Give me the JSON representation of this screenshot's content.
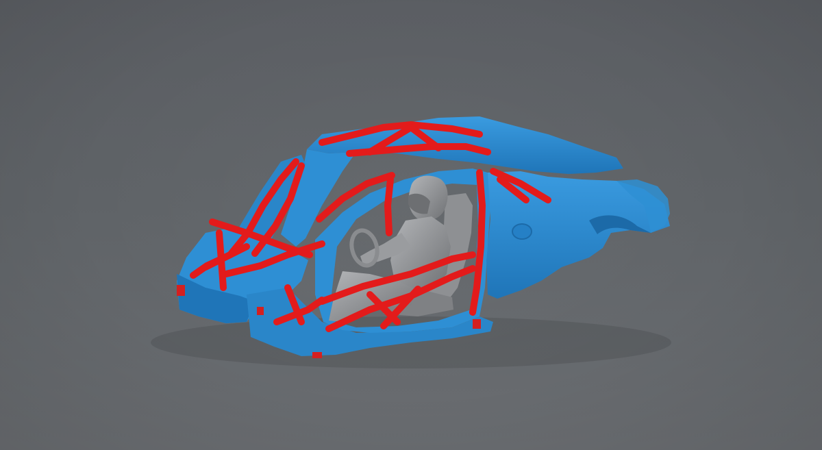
{
  "scene": {
    "colors": {
      "background_top": "#5b5e63",
      "background_bottom": "#6a6d71",
      "body_shell": "#2e8fd4",
      "body_shell_dark": "#1f6fb0",
      "roll_cage": "#e31b1b",
      "roll_cage_dark": "#a80f0f",
      "driver": "#9a9c9f",
      "driver_dark": "#6d6f72",
      "seat": "#8e9093"
    },
    "objects": [
      {
        "name": "scanned-car-body-shell",
        "color_role": "body_shell"
      },
      {
        "name": "roll-cage",
        "color_role": "roll_cage"
      },
      {
        "name": "driver-figure",
        "color_role": "driver"
      },
      {
        "name": "racing-seat",
        "color_role": "seat"
      }
    ]
  }
}
